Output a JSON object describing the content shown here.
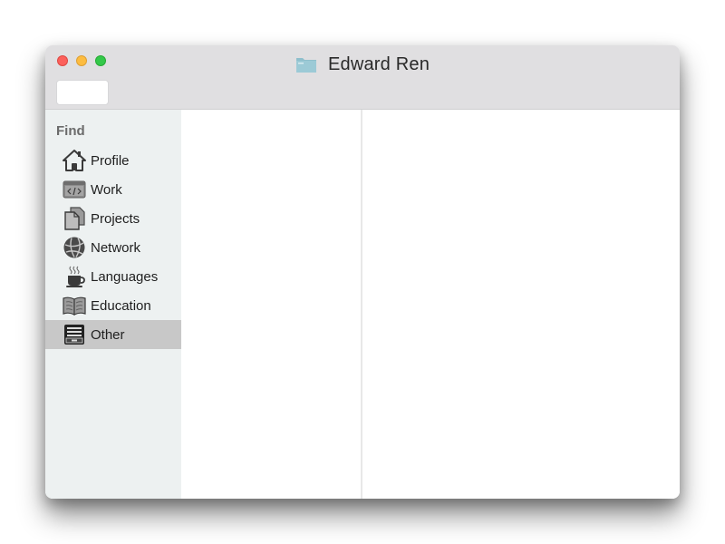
{
  "window": {
    "title": "Edward Ren",
    "title_icon": "folder-icon"
  },
  "traffic_lights": {
    "close_color": "#fc605b",
    "minimize_color": "#fdbc40",
    "zoom_color": "#34c84a"
  },
  "sidebar": {
    "heading": "Find",
    "selected_index": 6,
    "selected_color": "#c8c8c8",
    "items": [
      {
        "label": "Profile",
        "icon": "house-icon"
      },
      {
        "label": "Work",
        "icon": "code-window-icon"
      },
      {
        "label": "Projects",
        "icon": "documents-icon"
      },
      {
        "label": "Network",
        "icon": "globe-icon"
      },
      {
        "label": "Languages",
        "icon": "coffee-cup-icon"
      },
      {
        "label": "Education",
        "icon": "open-book-icon"
      },
      {
        "label": "Other",
        "icon": "file-cabinet-icon"
      }
    ]
  }
}
